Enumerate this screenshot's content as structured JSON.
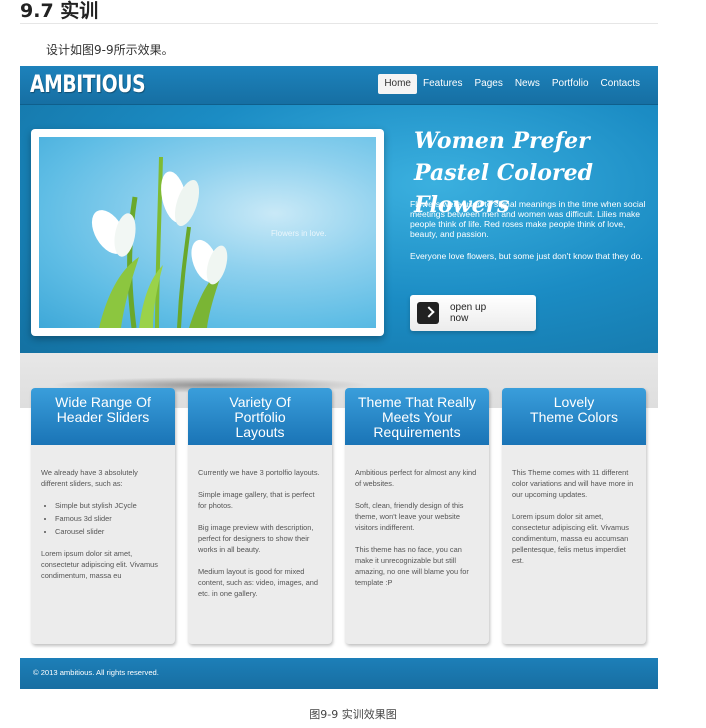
{
  "section": {
    "title": "9.7 实训",
    "intro": "设计如图9-9所示效果。"
  },
  "site": {
    "logo": "AMBITIOUS",
    "nav": [
      "Home",
      "Features",
      "Pages",
      "News",
      "Portfolio",
      "Contacts"
    ],
    "active_nav": "Home",
    "photo_caption": "Flowers in love.",
    "hero": {
      "title_line1": "Women Prefer",
      "title_line2": "Pastel Colored Flowers",
      "para1": "Flowers were used to signal meanings in the time when social meetings between men and women was difficult. Lilies make people think of life. Red roses make people think of love, beauty, and passion.",
      "para2": "Everyone love flowers, but some just don't know that they do.",
      "cta_line1": "open up",
      "cta_line2": "now"
    },
    "boxes": [
      {
        "title": [
          "Wide Range Of",
          "Header Sliders"
        ],
        "p1": "We already have 3 absolutely different sliders, such as:",
        "list": [
          "Simple but stylish JCycle",
          "Famous 3d slider",
          "Carousel slider"
        ],
        "p2": "Lorem ipsum dolor sit amet, consectetur adipiscing elit. Vivamus condimentum, massa eu"
      },
      {
        "title": [
          "Variety Of",
          "Portfolio",
          "Layouts"
        ],
        "p1": "Currently we have 3 portolfio layouts.",
        "p2": "Simple image gallery, that is perfect for photos.",
        "p3": "Big image preview with description, perfect for designers to show their works in all beauty.",
        "p4": "Medium layout is good for mixed content, such as: video, images, and etc. in one gallery."
      },
      {
        "title": [
          "Theme That Really",
          "Meets Your",
          "Requirements"
        ],
        "p1": "Ambitious perfect for almost any kind of websites.",
        "p2": "Soft, clean, friendly design of this theme, won't leave your website visitors indifferent.",
        "p3": "This theme has no face, you can make it unrecognizable but still amazing, no one will blame you for template :P"
      },
      {
        "title": [
          "Lovely",
          "Theme Colors"
        ],
        "p1": "This Theme comes with 11 different color variations and will have more in our upcoming updates.",
        "p2": "Lorem ipsum dolor sit amet, consectetur adipiscing elit. Vivamus condimentum, massa eu accumsan pellentesque, felis metus imperdiet est."
      }
    ],
    "footer": "© 2013 ambitious. All rights reserved."
  },
  "figure_caption": "图9-9 实训效果图",
  "colors": {
    "brand_blue": "#1b7fba",
    "box_bg": "#ececec",
    "ground": "#e4e4e4"
  }
}
